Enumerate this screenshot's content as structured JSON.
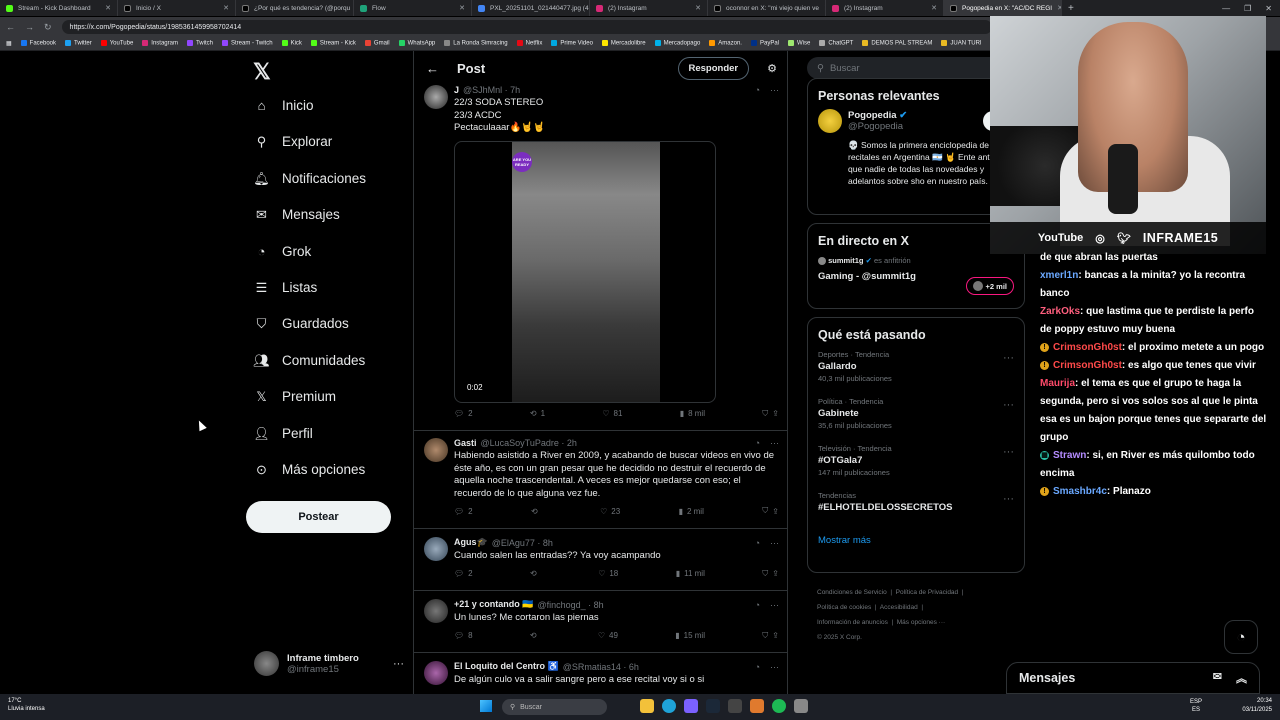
{
  "browser": {
    "tabs": [
      {
        "label": "Stream - Kick Dashboard",
        "color": "#53fc18"
      },
      {
        "label": "Inicio / X",
        "color": "#000000"
      },
      {
        "label": "¿Por qué es tendencia? (@porqu",
        "color": "#000000"
      },
      {
        "label": "Flow",
        "color": "#1fa37a"
      },
      {
        "label": "PXL_20251101_021440477.jpg (4",
        "color": "#4285f4"
      },
      {
        "label": "(2) Instagram",
        "color": "#d62976"
      },
      {
        "label": "oconnor en X: \"mi viejo quien ve",
        "color": "#000000"
      },
      {
        "label": "(2) Instagram",
        "color": "#d62976"
      },
      {
        "label": "Pogopedia en X: \"AC/DC REGI",
        "color": "#000000"
      }
    ],
    "url": "https://x.com/Pogopedia/status/1985361459958702414",
    "bookmarks": [
      "Facebook",
      "Twitter",
      "YouTube",
      "Instagram",
      "Twitch",
      "Stream - Twitch",
      "Kick",
      "Stream - Kick",
      "Gmail",
      "WhatsApp",
      "La Ronda Simracing",
      "Netflix",
      "Prime Video",
      "Mercadolibre",
      "Mercadopago",
      "Amazon.",
      "PayPal",
      "Wise",
      "ChatGPT",
      "DEMOS PAL STREAM",
      "JUAN TURI"
    ]
  },
  "nav": {
    "items": [
      {
        "label": "Inicio",
        "icon": "home-icon"
      },
      {
        "label": "Explorar",
        "icon": "search-icon"
      },
      {
        "label": "Notificaciones",
        "icon": "bell-icon"
      },
      {
        "label": "Mensajes",
        "icon": "mail-icon"
      },
      {
        "label": "Grok",
        "icon": "grok-icon"
      },
      {
        "label": "Listas",
        "icon": "list-icon"
      },
      {
        "label": "Guardados",
        "icon": "bookmark-icon"
      },
      {
        "label": "Comunidades",
        "icon": "communities-icon"
      },
      {
        "label": "Premium",
        "icon": "x-icon"
      },
      {
        "label": "Perfil",
        "icon": "person-icon"
      },
      {
        "label": "Más opciones",
        "icon": "more-icon"
      }
    ],
    "post_label": "Postear",
    "user": {
      "name": "Inframe timbero",
      "handle": "@inframe15"
    }
  },
  "post": {
    "title": "Post",
    "reply_label": "Responder"
  },
  "tweets": [
    {
      "name": "J",
      "handle": "@SJhMnl · 7h",
      "lines": [
        "22/3 SODA STEREO",
        "23/3 ACDC",
        "Pectaculaaar🔥🤘🤘"
      ],
      "video_time": "0:02",
      "replies": "2",
      "retweets": "1",
      "likes": "81",
      "views": "8 mil"
    },
    {
      "name": "Gasti",
      "handle": "@LucaSoyTuPadre · 2h",
      "lines": [
        "Habiendo asistido a River en 2009, y acabando de buscar videos en vivo de éste año, es con un gran pesar que he decidido no destruir el recuerdo de aquella noche trascendental. A veces es mejor quedarse con eso; el recuerdo de lo que alguna vez fue."
      ],
      "replies": "2",
      "retweets": "",
      "likes": "23",
      "views": "2 mil"
    },
    {
      "name": "Agus🎓",
      "handle": "@ElAgu77 · 8h",
      "lines": [
        "Cuando salen las entradas?? Ya voy acampando"
      ],
      "replies": "2",
      "retweets": "",
      "likes": "18",
      "views": "11 mil"
    },
    {
      "name": "+21 y contando 🇺🇦",
      "handle": "@finchogd_ · 8h",
      "lines": [
        "Un lunes? Me cortaron las piernas"
      ],
      "replies": "8",
      "retweets": "",
      "likes": "49",
      "views": "15 mil"
    },
    {
      "name": "El Loquito del Centro ♿",
      "handle": "@SRmatias14 · 6h",
      "lines": [
        "De algún culo va a salir sangre pero a ese recital voy si o si"
      ]
    }
  ],
  "sidebar": {
    "search_placeholder": "Buscar",
    "relevant": {
      "title": "Personas relevantes",
      "name": "Pogopedia",
      "handle": "@Pogopedia",
      "follow_label": "Se",
      "bio": "💀 Somos la primera enciclopedia de recitales en Argentina 🇦🇷 🤘 Ente antes que nadie de todas las novedades y adelantos sobre sho en nuestro país."
    },
    "live": {
      "title": "En directo en X",
      "host": "summit1g",
      "host_suffix": "es anfitrión",
      "stream": "Gaming - @summit1g",
      "viewers": "+2 mil"
    },
    "trends": {
      "title": "Qué está pasando",
      "items": [
        {
          "context": "Deportes · Tendencia",
          "name": "Gallardo",
          "meta": "40,3 mil publicaciones"
        },
        {
          "context": "Política · Tendencia",
          "name": "Gabinete",
          "meta": "35,6 mil publicaciones"
        },
        {
          "context": "Televisión · Tendencia",
          "name": "#OTGala7",
          "meta": "147 mil publicaciones"
        },
        {
          "context": "Tendencias",
          "name": "#ELHOTELDELOSSECRETOS",
          "meta": ""
        }
      ],
      "show_more": "Mostrar más"
    },
    "footer": [
      "Condiciones de Servicio",
      "Política de Privacidad",
      "Política de cookies",
      "Accesibilidad",
      "Información de anuncios",
      "Más opciones ···",
      "© 2025 X Corp."
    ]
  },
  "stream": {
    "labels": [
      "YouTube",
      "INFRAME15"
    ],
    "chat": [
      {
        "user": "",
        "text": "de que abran las puertas",
        "color": "#ffffff"
      },
      {
        "user": "xmerl1n",
        "text": ": bancas a la minita? yo la recontra banco",
        "color": "#6aa8ff"
      },
      {
        "user": "ZarkOks",
        "text": ": que lastima que te perdiste la perfo de poppy estuvo muy buena",
        "color": "#ff5f7e"
      },
      {
        "user": "CrimsonGh0st",
        "text": ": el proximo metete a un pogo",
        "color": "#ff4a4a",
        "badge": true
      },
      {
        "user": "CrimsonGh0st",
        "text": ": es algo que tenes que vivir",
        "color": "#ff4a4a",
        "badge": true
      },
      {
        "user": "Maurija",
        "text": ": el tema es que el grupo te haga la segunda, pero si vos solos sos al que le pinta esa es un bajon porque tenes que separarte del grupo",
        "color": "#ff4a6a"
      },
      {
        "user": "Strawn",
        "text": ": si, en River es más quilombo todo encima",
        "color": "#b48cff",
        "badge": true
      },
      {
        "user": "Smashbr4c",
        "text": ": Planazo",
        "color": "#6aa8ff",
        "badge": true
      }
    ]
  },
  "messages_label": "Mensajes",
  "taskbar": {
    "weather_temp": "17°C",
    "weather_desc": "Lluvia intensa",
    "search_placeholder": "Buscar",
    "lang": "ESP",
    "region": "ES",
    "time": "20:34",
    "date": "03/11/2025"
  }
}
